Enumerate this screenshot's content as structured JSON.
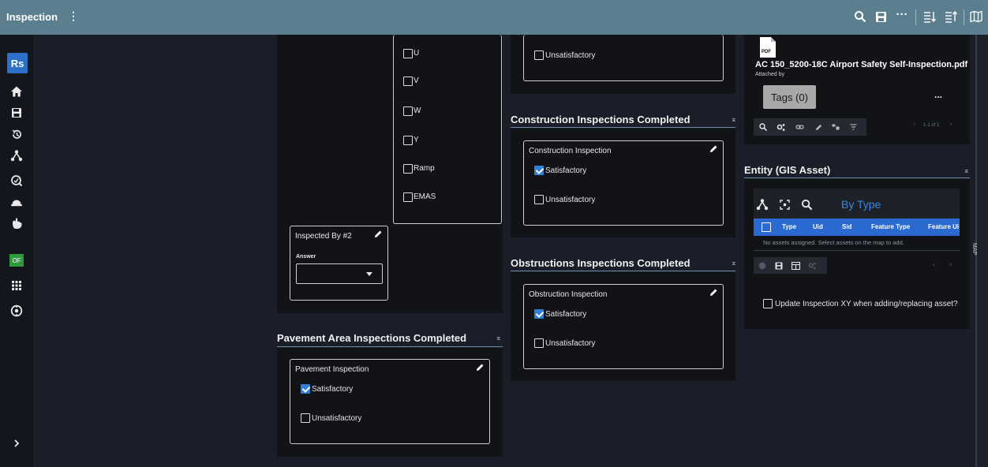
{
  "app": {
    "title": "Inspection",
    "menu_icon": "kebab-vertical-icon"
  },
  "toolbar": {
    "icons": [
      "search-icon",
      "save-icon",
      "more-horizontal-icon",
      "collapse-all-icon",
      "expand-all-icon",
      "map-icon"
    ]
  },
  "sidebar": {
    "logo": "Rs",
    "badge_label": "OF",
    "icons": [
      "home-icon",
      "save-icon",
      "history-icon",
      "workflow-icon",
      "search-circle-icon",
      "hardhat-icon",
      "hand-icon",
      "grid-icon",
      "help-circle-icon",
      "chevron-right-icon"
    ]
  },
  "column1": {
    "checkbox_options": [
      "U",
      "V",
      "W",
      "Y",
      "Ramp",
      "EMAS"
    ],
    "inspected_by2": {
      "title": "Inspected By #2",
      "answer_label": "Answer",
      "value": ""
    }
  },
  "pavement": {
    "section_title": "Pavement Area Inspections Completed",
    "card_title": "Pavement Inspection",
    "options": [
      {
        "label": "Satisfactory",
        "checked": true
      },
      {
        "label": "Unsatisfactory",
        "checked": false
      }
    ]
  },
  "column2_top": {
    "unsatisfactory_label": "Unsatisfactory"
  },
  "construction": {
    "section_title": "Construction Inspections Completed",
    "card_title": "Construction Inspection",
    "options": [
      {
        "label": "Satisfactory",
        "checked": true
      },
      {
        "label": "Unsatisfactory",
        "checked": false
      }
    ]
  },
  "obstructions": {
    "section_title": "Obstructions Inspections Completed",
    "card_title": "Obstruction Inspection",
    "options": [
      {
        "label": "Satisfactory",
        "checked": true
      },
      {
        "label": "Unsatisfactory",
        "checked": false
      }
    ]
  },
  "attachment": {
    "file_icon_label": "PDF",
    "file_name": "AC 150_5200-18C Airport Safety Self-Inspection.pdf",
    "attached_by": "Attached by",
    "tags_button": "Tags (0)",
    "more": "...",
    "pagination": "1-1 of 1",
    "tool_icons": [
      "search-icon",
      "settings-icon",
      "link-icon",
      "edit-icon",
      "tag-icon",
      "filter-icon",
      "chevron-left-icon",
      "chevron-right-icon"
    ]
  },
  "entity": {
    "section_title": "Entity (GIS Asset)",
    "mode_label": "By Type",
    "columns": [
      "Type",
      "Uid",
      "Sid",
      "Feature Type",
      "Feature Ui"
    ],
    "empty_message": "No assets assigned. Select assets on the map to add.",
    "update_label": "Update Inspection XY when adding/replacing asset?"
  },
  "right_strip": {
    "label": "MAP"
  },
  "colors": {
    "topbar": "#5b7f8f",
    "accent": "#2f80d6",
    "header_row": "#2b6ad0",
    "by_type": "#3a86e0"
  }
}
